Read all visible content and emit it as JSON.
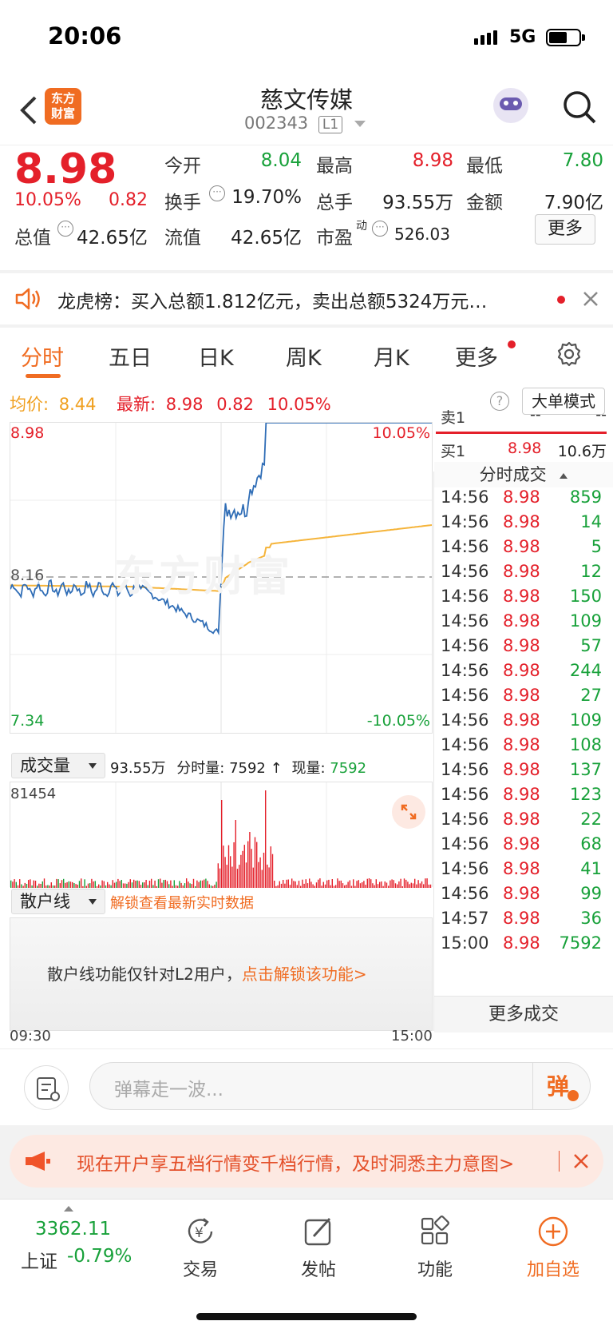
{
  "status": {
    "time": "20:06",
    "network": "5G"
  },
  "header": {
    "logo": "东方财富",
    "title": "慈文传媒",
    "code": "002343",
    "level": "L1"
  },
  "quote": {
    "price": "8.98",
    "change_pct": "10.05%",
    "change": "0.82",
    "open_label": "今开",
    "open": "8.04",
    "high_label": "最高",
    "high": "8.98",
    "low_label": "最低",
    "low": "7.80",
    "turnover_label": "换手",
    "turnover": "19.70%",
    "volume_label": "总手",
    "volume": "93.55万",
    "amount_label": "金额",
    "amount": "7.90亿",
    "mktcap_label": "总值",
    "mktcap": "42.65亿",
    "float_label": "流值",
    "float": "42.65亿",
    "pe_label": "市盈",
    "pe_sup": "动",
    "pe": "526.03",
    "more": "更多"
  },
  "notice": {
    "text": "龙虎榜：买入总额1.812亿元，卖出总额5324万元…"
  },
  "tabs": [
    "分时",
    "五日",
    "日K",
    "周K",
    "月K",
    "更多"
  ],
  "info": {
    "avg_label": "均价:",
    "avg": "8.44",
    "latest_label": "最新:",
    "latest": "8.98",
    "chg": "0.82",
    "pct": "10.05%",
    "bigorder": "大单模式"
  },
  "chart": {
    "ymax": "8.98",
    "ymin": "7.34",
    "pmax": "10.05%",
    "pmin": "-10.05%",
    "mid": "8.16",
    "watermark": "东方财富",
    "tstart": "09:30",
    "tend": "15:00"
  },
  "volume": {
    "selector": "成交量",
    "total": "93.55万",
    "minute_label": "分时量:",
    "minute": "7592",
    "arrow": "↑",
    "now_label": "现量:",
    "now": "7592",
    "max": "81454"
  },
  "retail": {
    "selector": "散户线",
    "unlock": "解锁查看最新实时数据",
    "msg": "散户线功能仅针对L2用户，",
    "link": "点击解锁该功能>"
  },
  "orderbook": {
    "sell1_label": "卖1",
    "sell1_price": "--",
    "sell1_vol": "--",
    "buy1_label": "买1",
    "buy1_price": "8.98",
    "buy1_vol": "10.6万"
  },
  "trades_title": "分时成交",
  "trades": [
    {
      "t": "14:56",
      "p": "8.98",
      "v": "859"
    },
    {
      "t": "14:56",
      "p": "8.98",
      "v": "14"
    },
    {
      "t": "14:56",
      "p": "8.98",
      "v": "5"
    },
    {
      "t": "14:56",
      "p": "8.98",
      "v": "12"
    },
    {
      "t": "14:56",
      "p": "8.98",
      "v": "150"
    },
    {
      "t": "14:56",
      "p": "8.98",
      "v": "109"
    },
    {
      "t": "14:56",
      "p": "8.98",
      "v": "57"
    },
    {
      "t": "14:56",
      "p": "8.98",
      "v": "244"
    },
    {
      "t": "14:56",
      "p": "8.98",
      "v": "27"
    },
    {
      "t": "14:56",
      "p": "8.98",
      "v": "109"
    },
    {
      "t": "14:56",
      "p": "8.98",
      "v": "108"
    },
    {
      "t": "14:56",
      "p": "8.98",
      "v": "137"
    },
    {
      "t": "14:56",
      "p": "8.98",
      "v": "123"
    },
    {
      "t": "14:56",
      "p": "8.98",
      "v": "22"
    },
    {
      "t": "14:56",
      "p": "8.98",
      "v": "68"
    },
    {
      "t": "14:56",
      "p": "8.98",
      "v": "41"
    },
    {
      "t": "14:56",
      "p": "8.98",
      "v": "99"
    },
    {
      "t": "14:57",
      "p": "8.98",
      "v": "36"
    },
    {
      "t": "15:00",
      "p": "8.98",
      "v": "7592"
    }
  ],
  "more_trades": "更多成交",
  "danmu": {
    "placeholder": "弹幕走一波...",
    "send": "弹"
  },
  "banner": {
    "text": "现在开户享五档行情变千档行情，及时洞悉主力意图>"
  },
  "bottomnav": {
    "index_value": "3362.11",
    "index_name": "上证",
    "index_chg": "-0.79%",
    "items": [
      "交易",
      "发帖",
      "功能",
      "加自选"
    ]
  },
  "colors": {
    "up": "#e4202a",
    "down": "#18a13a",
    "accent": "#f06c22",
    "price_line": "#2f6db6",
    "avg_line": "#f5b43a"
  }
}
